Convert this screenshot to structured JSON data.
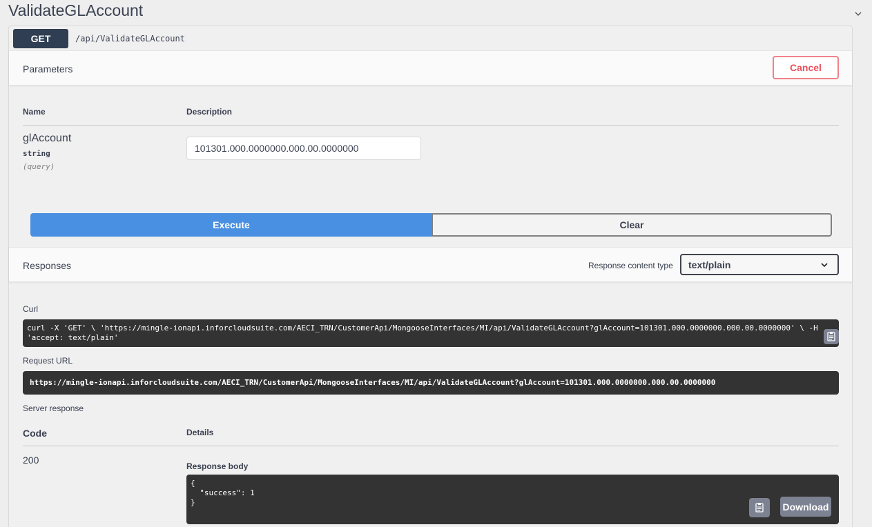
{
  "page": {
    "title": "ValidateGLAccount"
  },
  "operation": {
    "method": "GET",
    "path": "/api/ValidateGLAccount"
  },
  "parameters": {
    "section_label": "Parameters",
    "cancel_label": "Cancel",
    "col_name": "Name",
    "col_description": "Description",
    "items": [
      {
        "name": "glAccount",
        "type": "string",
        "in": "(query)",
        "value": "101301.000.0000000.000.00.0000000"
      }
    ]
  },
  "actions": {
    "execute_label": "Execute",
    "clear_label": "Clear"
  },
  "responses": {
    "section_label": "Responses",
    "content_type_label": "Response content type",
    "content_type_value": "text/plain",
    "curl_label": "Curl",
    "curl_text": "curl -X 'GET' \\ 'https://mingle-ionapi.inforcloudsuite.com/AECI_TRN/CustomerApi/MongooseInterfaces/MI/api/ValidateGLAccount?glAccount=101301.000.0000000.000.00.0000000' \\ -H 'accept: text/plain'",
    "request_url_label": "Request URL",
    "request_url": "https://mingle-ionapi.inforcloudsuite.com/AECI_TRN/CustomerApi/MongooseInterfaces/MI/api/ValidateGLAccount?glAccount=101301.000.0000000.000.00.0000000",
    "server_response_label": "Server response",
    "col_code": "Code",
    "col_details": "Details",
    "status_code": "200",
    "response_body_label": "Response body",
    "response_body": "{\n  \"success\": 1\n}",
    "download_label": "Download"
  },
  "colors": {
    "method_badge": "#2f3e52",
    "execute": "#4990e2",
    "cancel": "#e9505c",
    "code_bg": "#333333"
  },
  "icons": [
    "chevron-down-icon",
    "clipboard-copy-icon"
  ]
}
